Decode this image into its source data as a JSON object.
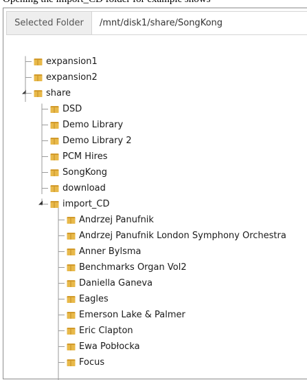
{
  "caption": "Opening the import_CD folder for example shows",
  "selected_folder": {
    "label": "Selected Folder",
    "path": "/mnt/disk1/share/SongKong"
  },
  "tree": [
    {
      "label": "expansion1",
      "level": 1,
      "expanded": false
    },
    {
      "label": "expansion2",
      "level": 1,
      "expanded": false
    },
    {
      "label": "share",
      "level": 1,
      "expanded": true
    },
    {
      "label": "DSD",
      "level": 2,
      "expanded": false
    },
    {
      "label": "Demo Library",
      "level": 2,
      "expanded": false
    },
    {
      "label": "Demo Library 2",
      "level": 2,
      "expanded": false
    },
    {
      "label": "PCM Hires",
      "level": 2,
      "expanded": false
    },
    {
      "label": "SongKong",
      "level": 2,
      "expanded": false
    },
    {
      "label": "download",
      "level": 2,
      "expanded": false
    },
    {
      "label": "import_CD",
      "level": 2,
      "expanded": true
    },
    {
      "label": "Andrzej Panufnik",
      "level": 3,
      "expanded": false
    },
    {
      "label": "Andrzej Panufnik London Symphony Orchestra",
      "level": 3,
      "expanded": false
    },
    {
      "label": "Anner Bylsma",
      "level": 3,
      "expanded": false
    },
    {
      "label": "Benchmarks Organ Vol2",
      "level": 3,
      "expanded": false
    },
    {
      "label": "Daniella Ganeva",
      "level": 3,
      "expanded": false
    },
    {
      "label": "Eagles",
      "level": 3,
      "expanded": false
    },
    {
      "label": "Emerson Lake & Palmer",
      "level": 3,
      "expanded": false
    },
    {
      "label": "Eric Clapton",
      "level": 3,
      "expanded": false
    },
    {
      "label": "Ewa Pobłocka",
      "level": 3,
      "expanded": false
    },
    {
      "label": "Focus",
      "level": 3,
      "expanded": false
    }
  ],
  "colors": {
    "folder_fill": "#e8b94a",
    "folder_tab": "#d29a2a",
    "tree_line": "#9a9a9a"
  }
}
